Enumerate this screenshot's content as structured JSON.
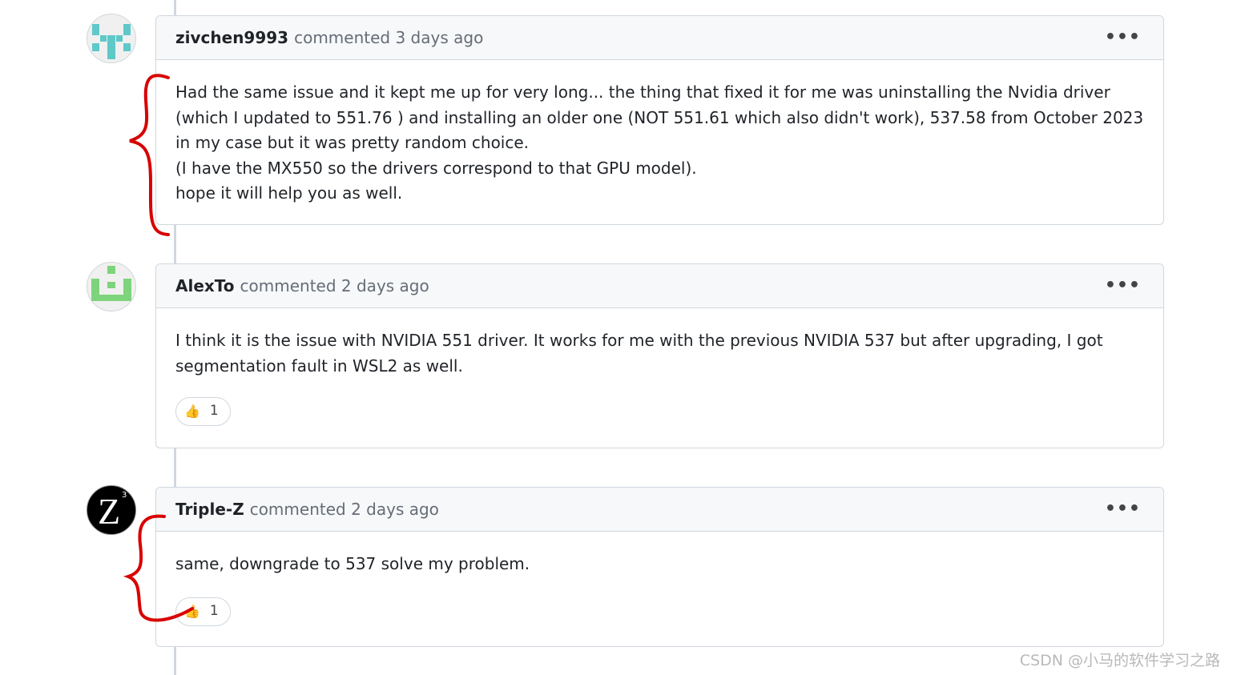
{
  "comments": [
    {
      "author": "zivchen9993",
      "meta": "commented 3 days ago",
      "menu_label": "•••",
      "body_lines": [
        "Had the same issue and it kept me up for very long... the thing that fixed it for me was uninstalling the Nvidia driver (which I updated to 551.76 ) and installing an older one (NOT 551.61 which also didn't work), 537.58 from October 2023 in my case but it was pretty random choice.",
        "(I have the MX550 so the drivers correspond to that GPU model).",
        "hope it will help you as well."
      ],
      "avatar_color": "#5fc8c9"
    },
    {
      "author": "AlexTo",
      "meta": "commented 2 days ago",
      "menu_label": "•••",
      "body_lines": [
        "I think it is the issue with NVIDIA 551 driver. It works for me with the previous NVIDIA 537 but after upgrading, I got segmentation fault in WSL2 as well."
      ],
      "reaction": {
        "emoji": "👍",
        "count": "1"
      },
      "avatar_color": "#7ed47a"
    },
    {
      "author": "Triple-Z",
      "meta": "commented 2 days ago",
      "menu_label": "•••",
      "body_lines": [
        "same, downgrade to 537 solve my problem."
      ],
      "reaction": {
        "emoji": "👍",
        "count": "1"
      },
      "avatar_color": "#000000",
      "avatar_text": "Z",
      "avatar_sup": "3"
    }
  ],
  "annotation_color": "#d80000",
  "watermark": "CSDN @小马的软件学习之路"
}
